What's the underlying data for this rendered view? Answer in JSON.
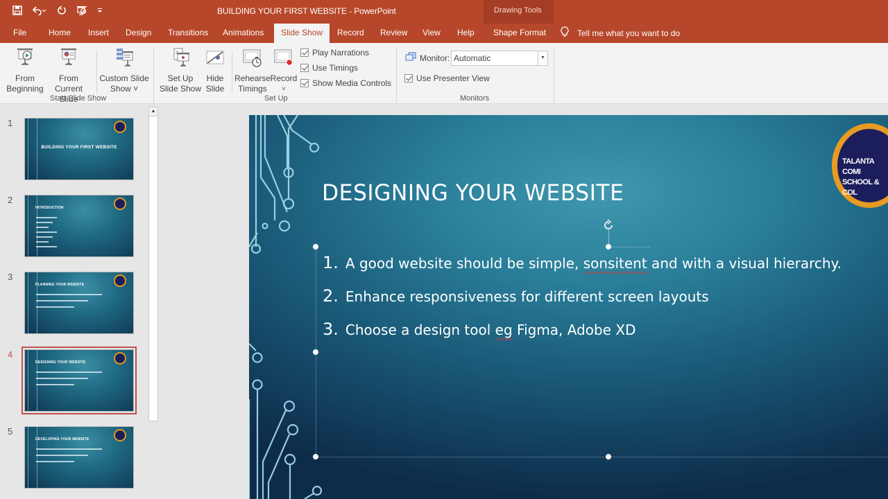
{
  "window": {
    "title": "BUILDING YOUR FIRST WEBSITE  -  PowerPoint",
    "contextual_tab_group": "Drawing Tools"
  },
  "quick_access": [
    "save-icon",
    "undo-icon",
    "redo-icon",
    "start-from-beginning-icon",
    "customize-qat-icon"
  ],
  "tabs": [
    {
      "label": "File"
    },
    {
      "label": "Home"
    },
    {
      "label": "Insert"
    },
    {
      "label": "Design"
    },
    {
      "label": "Transitions"
    },
    {
      "label": "Animations"
    },
    {
      "label": "Slide Show",
      "active": true
    },
    {
      "label": "Record"
    },
    {
      "label": "Review"
    },
    {
      "label": "View"
    },
    {
      "label": "Help"
    },
    {
      "label": "Shape Format"
    }
  ],
  "tell_me": "Tell me what you want to do",
  "ribbon": {
    "start_slide_show": {
      "label": "Start Slide Show",
      "from_beginning": [
        "From",
        "Beginning"
      ],
      "from_current": [
        "From",
        "Current Slide"
      ],
      "custom_show": [
        "Custom Slide",
        "Show ˅"
      ]
    },
    "set_up": {
      "label": "Set Up",
      "set_up_show": [
        "Set Up",
        "Slide Show"
      ],
      "hide_slide": [
        "Hide",
        "Slide"
      ],
      "rehearse": [
        "Rehearse",
        "Timings"
      ],
      "record": [
        "Record",
        "˅"
      ],
      "play_narrations": "Play Narrations",
      "use_timings": "Use Timings",
      "show_media_controls": "Show Media Controls"
    },
    "monitors": {
      "label": "Monitors",
      "monitor_label": "Monitor:",
      "monitor_value": "Automatic",
      "use_presenter_view": "Use Presenter View"
    }
  },
  "thumbnails": [
    {
      "num": "1",
      "title": "BUILDING YOUR FIRST WEBSITE",
      "lines": 0
    },
    {
      "num": "2",
      "title": "INTRODUCTION",
      "lines": 7
    },
    {
      "num": "3",
      "title": "PLANNING YOUR WEBSITE",
      "lines": 3
    },
    {
      "num": "4",
      "title": "DESIGNING YOUR WEBSITE",
      "lines": 3,
      "selected": true
    },
    {
      "num": "5",
      "title": "DEVELOPING YOUR WEBSITE",
      "lines": 3
    }
  ],
  "slide": {
    "title": "DESIGNING YOUR WEBSITE",
    "items": [
      {
        "num": "1.",
        "pre": "A good website should be simple, ",
        "misspelled": "sonsitent",
        "post": " and with a visual hierarchy."
      },
      {
        "num": "2.",
        "pre": "Enhance responsiveness for different screen layouts",
        "misspelled": "",
        "post": ""
      },
      {
        "num": "3.",
        "pre": "Choose a design tool ",
        "misspelled": "eg",
        "post": " Figma, Adobe XD"
      }
    ],
    "logo_lines": [
      "TALANTA COMI",
      "SCHOOL & COL"
    ]
  },
  "colors": {
    "accent": "#b7472a",
    "selected_thumb": "#c0504d",
    "logo_ring": "#e79b22",
    "logo_fill": "#1c1d5c"
  }
}
